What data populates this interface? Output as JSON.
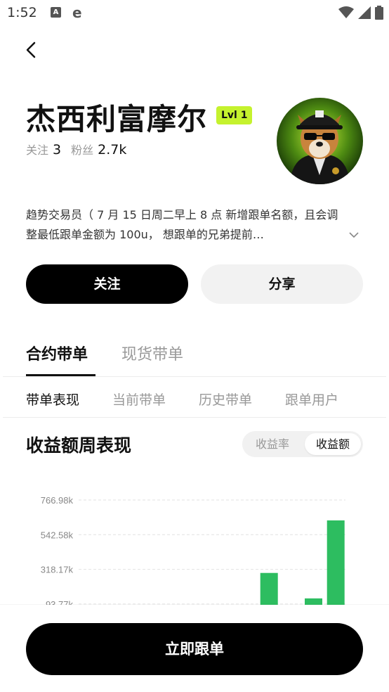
{
  "status_bar": {
    "time": "1:52",
    "left_icons": [
      "a-letter-icon",
      "browser-e-icon"
    ],
    "right_icons": [
      "wifi-icon",
      "signal-icon",
      "battery-icon"
    ]
  },
  "profile": {
    "name": "杰西利富摩尔",
    "level": "Lvl 1",
    "level_color": "#c5f22e",
    "following_label": "关注",
    "following_count": "3",
    "followers_label": "粉丝",
    "followers_count": "2.7k",
    "bio": "趋势交易员（ 7 月 15 日周二早上 8 点 新增跟单名额，且会调整最低跟单金额为 100u， 想跟单的兄弟提前…"
  },
  "actions": {
    "follow_label": "关注",
    "share_label": "分享"
  },
  "main_tabs": [
    {
      "label": "合约带单",
      "active": true
    },
    {
      "label": "现货带单",
      "active": false
    }
  ],
  "sub_tabs": [
    {
      "label": "带单表现",
      "active": true
    },
    {
      "label": "当前带单",
      "active": false
    },
    {
      "label": "历史带单",
      "active": false
    },
    {
      "label": "跟单用户",
      "active": false
    }
  ],
  "section": {
    "title": "收益额周表现",
    "toggle_options": [
      "收益率",
      "收益额"
    ],
    "toggle_selected": "收益额"
  },
  "chart_data": {
    "type": "bar",
    "y_ticks": [
      "766.98k",
      "542.58k",
      "318.17k",
      "93.77k"
    ],
    "y_tick_values": [
      766.98,
      542.58,
      318.17,
      93.77
    ],
    "ylabel": "",
    "grid": true,
    "bar_color": "#2dbd60",
    "values": [
      0,
      0,
      0,
      0,
      0,
      0,
      0,
      82,
      295,
      0,
      130,
      635
    ]
  },
  "bottom": {
    "copy_label": "立即跟单"
  },
  "colors": {
    "accent_green": "#2dbd60",
    "primary_button": "#000000"
  }
}
